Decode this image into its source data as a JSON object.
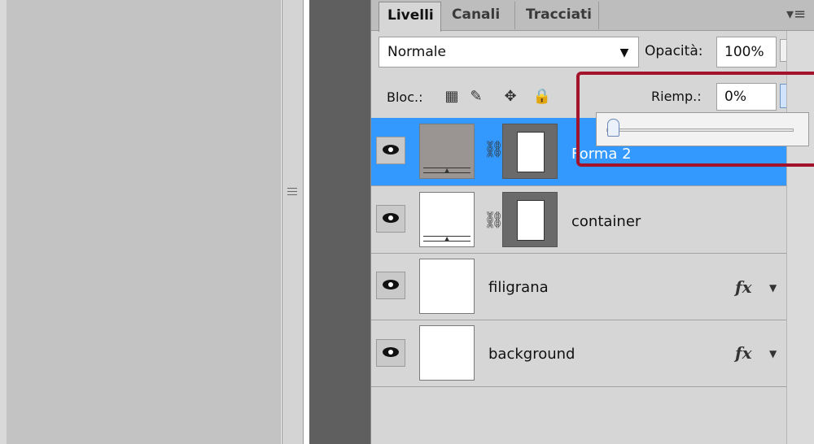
{
  "tabs": [
    "Livelli",
    "Canali",
    "Tracciati"
  ],
  "blend_mode": "Normale",
  "opacity": {
    "label": "Opacità:",
    "value": "100%"
  },
  "lock": {
    "label": "Bloc.:"
  },
  "fill": {
    "label": "Riemp.:",
    "value": "0%",
    "slider_value": 0
  },
  "layers": [
    {
      "name": "Forma 2",
      "selected": true,
      "type": "shape",
      "fx": false
    },
    {
      "name": "container",
      "selected": false,
      "type": "shape",
      "fx": false
    },
    {
      "name": "filigrana",
      "selected": false,
      "type": "raster",
      "fx": true
    },
    {
      "name": "background",
      "selected": false,
      "type": "raster",
      "fx": true
    }
  ],
  "fx_symbol": "fx",
  "colors": {
    "selection": "#3399ff",
    "highlight": "#a3132b"
  }
}
